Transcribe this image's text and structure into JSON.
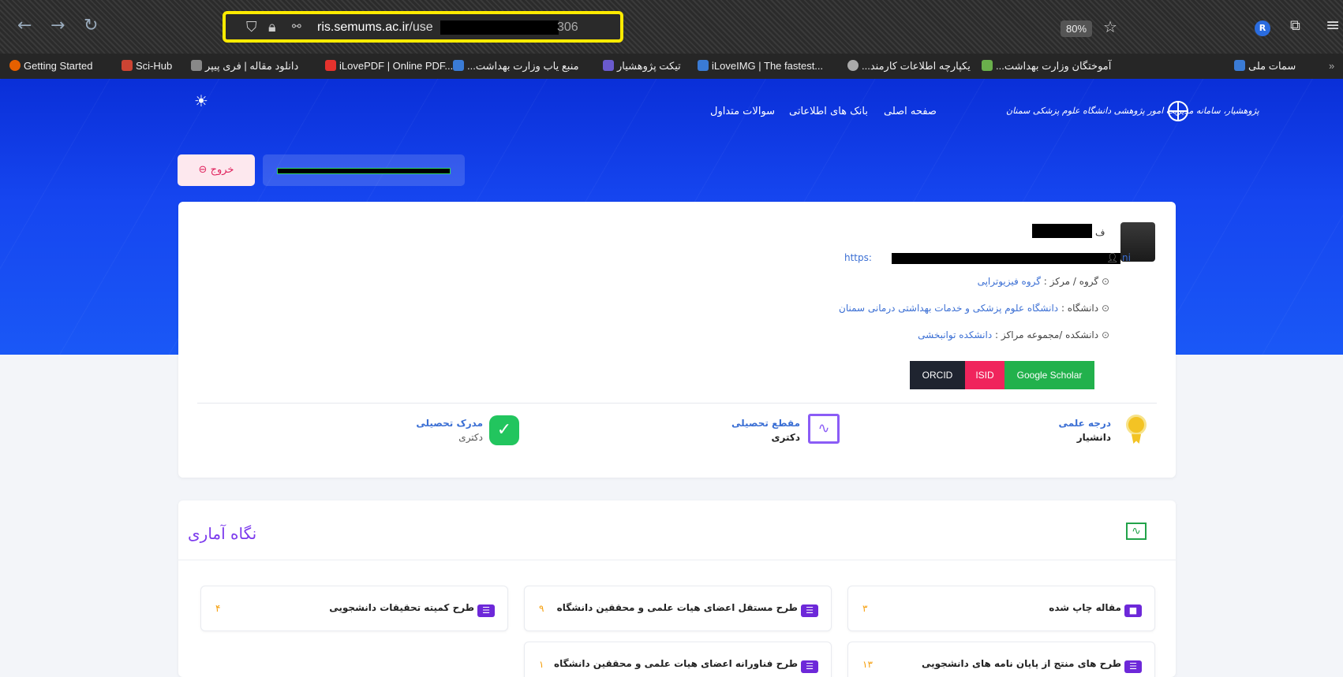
{
  "browser": {
    "url_host": "ris.semums.ac.ir",
    "url_path": "/use",
    "url_tail": "306",
    "zoom": "80%",
    "profile_initial": "R"
  },
  "bookmarks": [
    {
      "label": "Getting Started",
      "color": "#e66000"
    },
    {
      "label": "Sci-Hub",
      "color": "#c43"
    },
    {
      "label": "دانلود مقاله | فری پیپر",
      "color": "#888"
    },
    {
      "label": "iLovePDF | Online PDF...",
      "color": "#e5322d"
    },
    {
      "label": "منبع یاب وزارت بهداشت...",
      "color": "#3a7bd5"
    },
    {
      "label": "تیکت پژوهشیار",
      "color": "#6a5acd"
    },
    {
      "label": "iLoveIMG | The fastest...",
      "color": "#3a7bd5"
    },
    {
      "label": "یکپارچه اطلاعات کارمند...",
      "color": "#aaa"
    },
    {
      "label": "آموختگان وزارت بهداشت...",
      "color": "#6ab04c"
    },
    {
      "label": "سمات ملی",
      "color": "#3a7bd5"
    }
  ],
  "header": {
    "nav": [
      "صفحه اصلی",
      "بانک های اطلاعاتی",
      "سوالات متداول"
    ],
    "logo_text": "پژوهشیار، سامانه مدیریت امور پژوهشی دانشگاه علوم پزشکی سمنان",
    "logout": "خروج"
  },
  "profile": {
    "name_initial": "ف",
    "link_prefix": "https:",
    "link_suffix": "ni",
    "group_label": "گروه / مرکز :",
    "group_value": "گروه فیزیوتراپی",
    "university_label": "دانشگاه :",
    "university_value": "دانشگاه علوم پزشکی و خدمات بهداشتی درمانی سمنان",
    "faculty_label": "دانشکده /مجموعه مراکز :",
    "faculty_value": "دانشکده توانبخشی",
    "badges": [
      {
        "label": "ORCID",
        "color": "#1f2430"
      },
      {
        "label": "ISID",
        "color": "#f0245c"
      },
      {
        "label": "Google Scholar",
        "color": "#22b14c"
      }
    ],
    "stats": {
      "rank_title": "درجه علمی",
      "rank_value": "دانشیار",
      "degree_title": "مقطع تحصیلی",
      "degree_value": "دکتری",
      "cert_title": "مدرک تحصیلی",
      "cert_value": "دکتری"
    }
  },
  "statistics": {
    "title": "نگاه آماری",
    "tiles": [
      {
        "label": "مقاله چاپ شده",
        "count": "۳"
      },
      {
        "label": "طرح مستقل اعضای هیات علمی و محققین دانشگاه",
        "count": "۹"
      },
      {
        "label": "طرح کمیته تحقیقات دانشجویی",
        "count": "۴"
      },
      {
        "label": "طرح های منتج از پایان نامه های دانشجویی",
        "count": "۱۳"
      },
      {
        "label": "طرح فناورانه اعضای هیات علمی و محققین دانشگاه",
        "count": "۱"
      }
    ]
  }
}
